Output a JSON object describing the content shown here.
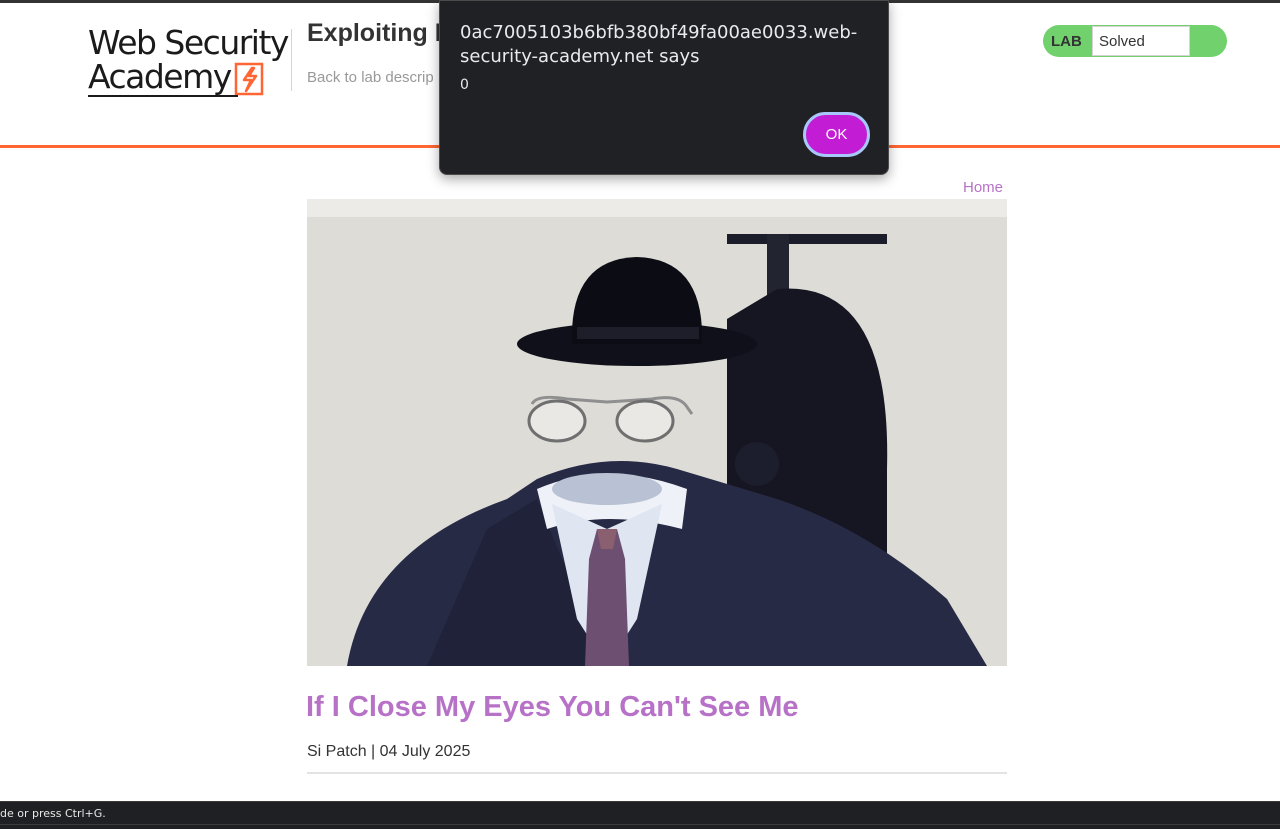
{
  "header": {
    "logo": {
      "line1": "Web Security",
      "line2": "Academy"
    },
    "lab_title": "Exploiting DO",
    "back_link": "Back to lab descrip",
    "lab_status": {
      "label": "LAB",
      "value": "Solved"
    }
  },
  "nav": {
    "home": "Home"
  },
  "post": {
    "image_alt": "Headless suit with bowler hat and glasses",
    "title": "If I Close My Eyes You Can't See Me",
    "meta": "Si Patch | 04 July 2025"
  },
  "alert_dialog": {
    "origin": "0ac7005103b6bfb380bf49fa00ae0033.web-security-academy.net says",
    "message": "0",
    "ok_label": "OK"
  },
  "bottom_bar": {
    "hint": "de or press Ctrl+G."
  },
  "colors": {
    "accent_orange": "#ff6633",
    "link_purple": "#b772c7",
    "lab_green": "#70d16d",
    "dialog_bg": "#202124",
    "ok_button": "#c21dd4"
  }
}
